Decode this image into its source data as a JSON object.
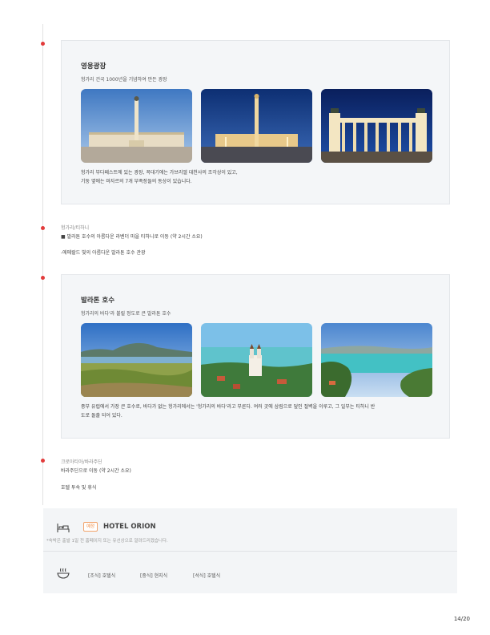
{
  "section1": {
    "title": "영웅광장",
    "subtitle": "헝가리 건국 1000년을 기념하여 만든 광장",
    "desc_line1": "헝가리 부다페스트에 있는 광장, 꼭대기에는 가브리엘 대천사의 조각상이 있고,",
    "desc_line2": "기둥 옆에는 마자르의 7개 부족장들의 동상이 있습니다."
  },
  "itinerary1": {
    "route": "헝가리/티하니",
    "transfer": "■ 발라톤 호수의 아름다운 라벤더 마을 티하니로 이동 (약 2시간 소요)",
    "highlight": "-에메랄드 빛의 아름다운 발라톤 호수 관광"
  },
  "section2": {
    "title": "발라톤 호수",
    "subtitle": "헝가리의 바다'라 불릴 정도로 큰 발라톤 호수",
    "desc_line1": "중부 유럽에서 가장 큰 호수로, 바다가 없는 헝가리에서는 '헝가리의 바다'라고 부른다. 여러 곳에 삼림으로 덮인 절벽을 이루고, 그 일부는 티하니 반",
    "desc_line2": "도로 돌출 되어 있다."
  },
  "itinerary2": {
    "route": "크로아티아/바라주딘",
    "transfer": "바라주딘으로 이동 (약 2시간 소요)",
    "highlight": "호텔 투숙 및 휴식"
  },
  "hotel": {
    "badge": "예정",
    "name": "HOTEL ORION",
    "note": "*숙박은 출발 1일 전 홈페이지 또는 유선상으로 알려드리겠습니다.",
    "meals": {
      "breakfast": "[조식] 호텔식",
      "lunch": "[중식] 현지식",
      "dinner": "[석식] 호텔식"
    }
  },
  "page": {
    "number": "14/20"
  },
  "icons": {
    "hotel": "bed-icon",
    "meal": "bowl-icon"
  },
  "colors": {
    "timeline_dot": "#e23b3b",
    "badge": "#f08a3e"
  }
}
